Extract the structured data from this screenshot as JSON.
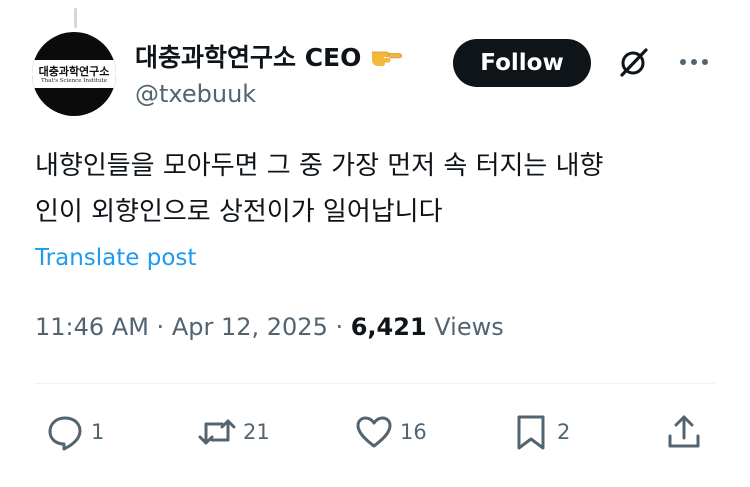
{
  "author": {
    "display_name": "대충과학연구소 CEO",
    "handle": "@txebuuk",
    "avatar": {
      "title": "대충과학연구소",
      "subtitle": "That's Science Institute"
    }
  },
  "header": {
    "follow_label": "Follow"
  },
  "tweet": {
    "lines": [
      "내향인들을 모아두면 그 중 가장 먼저 속 터지는 내향",
      "인이 외향인으로 상전이가 일어납니다"
    ]
  },
  "translate_label": "Translate post",
  "meta": {
    "time": "11:46 AM",
    "separator": " · ",
    "date": "Apr 12, 2025",
    "views_count": "6,421",
    "views_label": " Views"
  },
  "actions": {
    "replies": "1",
    "reposts": "21",
    "likes": "16",
    "bookmarks": "2"
  },
  "icons": [
    "hand-pointing-icon",
    "grok-icon",
    "more-icon",
    "reply-icon",
    "repost-icon",
    "like-icon",
    "bookmark-icon",
    "share-icon"
  ],
  "colors": {
    "text": "#0f1419",
    "muted": "#536471",
    "link": "#1d9bf0",
    "follow_bg": "#0f1419"
  }
}
